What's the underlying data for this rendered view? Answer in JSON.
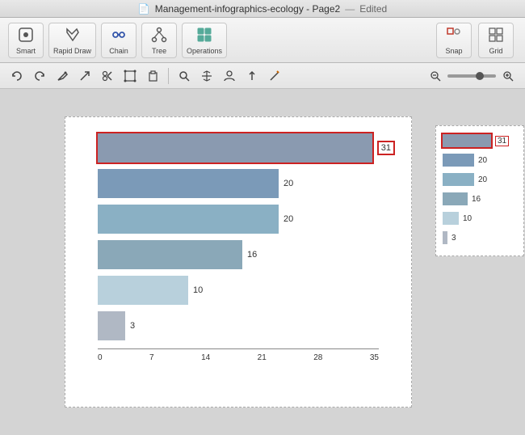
{
  "titlebar": {
    "title": "Management-infographics-ecology - Page2",
    "status": "Edited"
  },
  "toolbar": {
    "tools": [
      {
        "id": "smart",
        "label": "Smart",
        "icon": "⬡"
      },
      {
        "id": "rapid-draw",
        "label": "Rapid Draw",
        "icon": "✏️"
      },
      {
        "id": "chain",
        "label": "Chain",
        "icon": "⛓"
      },
      {
        "id": "tree",
        "label": "Tree",
        "icon": "🌳"
      },
      {
        "id": "operations",
        "label": "Operations",
        "icon": "⊞"
      }
    ],
    "right_tools": [
      {
        "id": "snap",
        "label": "Snap",
        "icon": "⊡"
      },
      {
        "id": "grid",
        "label": "Grid",
        "icon": "⊞"
      }
    ]
  },
  "secondary_toolbar": {
    "tools": [
      "↩",
      "↪",
      "✒",
      "↗",
      "✂",
      "⤢",
      "📋",
      "🔍",
      "✋",
      "👤",
      "⬆",
      "✨"
    ]
  },
  "chart": {
    "title": "Management-infographics-ecology",
    "bars": [
      {
        "value": 31,
        "color": "#8a9ab0",
        "selected": true
      },
      {
        "value": 20,
        "color": "#7b9ab8",
        "selected": false
      },
      {
        "value": 20,
        "color": "#8ab0c4",
        "selected": false
      },
      {
        "value": 16,
        "color": "#8aa8b8",
        "selected": false
      },
      {
        "value": 10,
        "color": "#b8d0dc",
        "selected": false
      },
      {
        "value": 3,
        "color": "#b0b8c4",
        "selected": false
      }
    ],
    "x_axis_labels": [
      "0",
      "7",
      "14",
      "21",
      "28",
      "35"
    ]
  }
}
